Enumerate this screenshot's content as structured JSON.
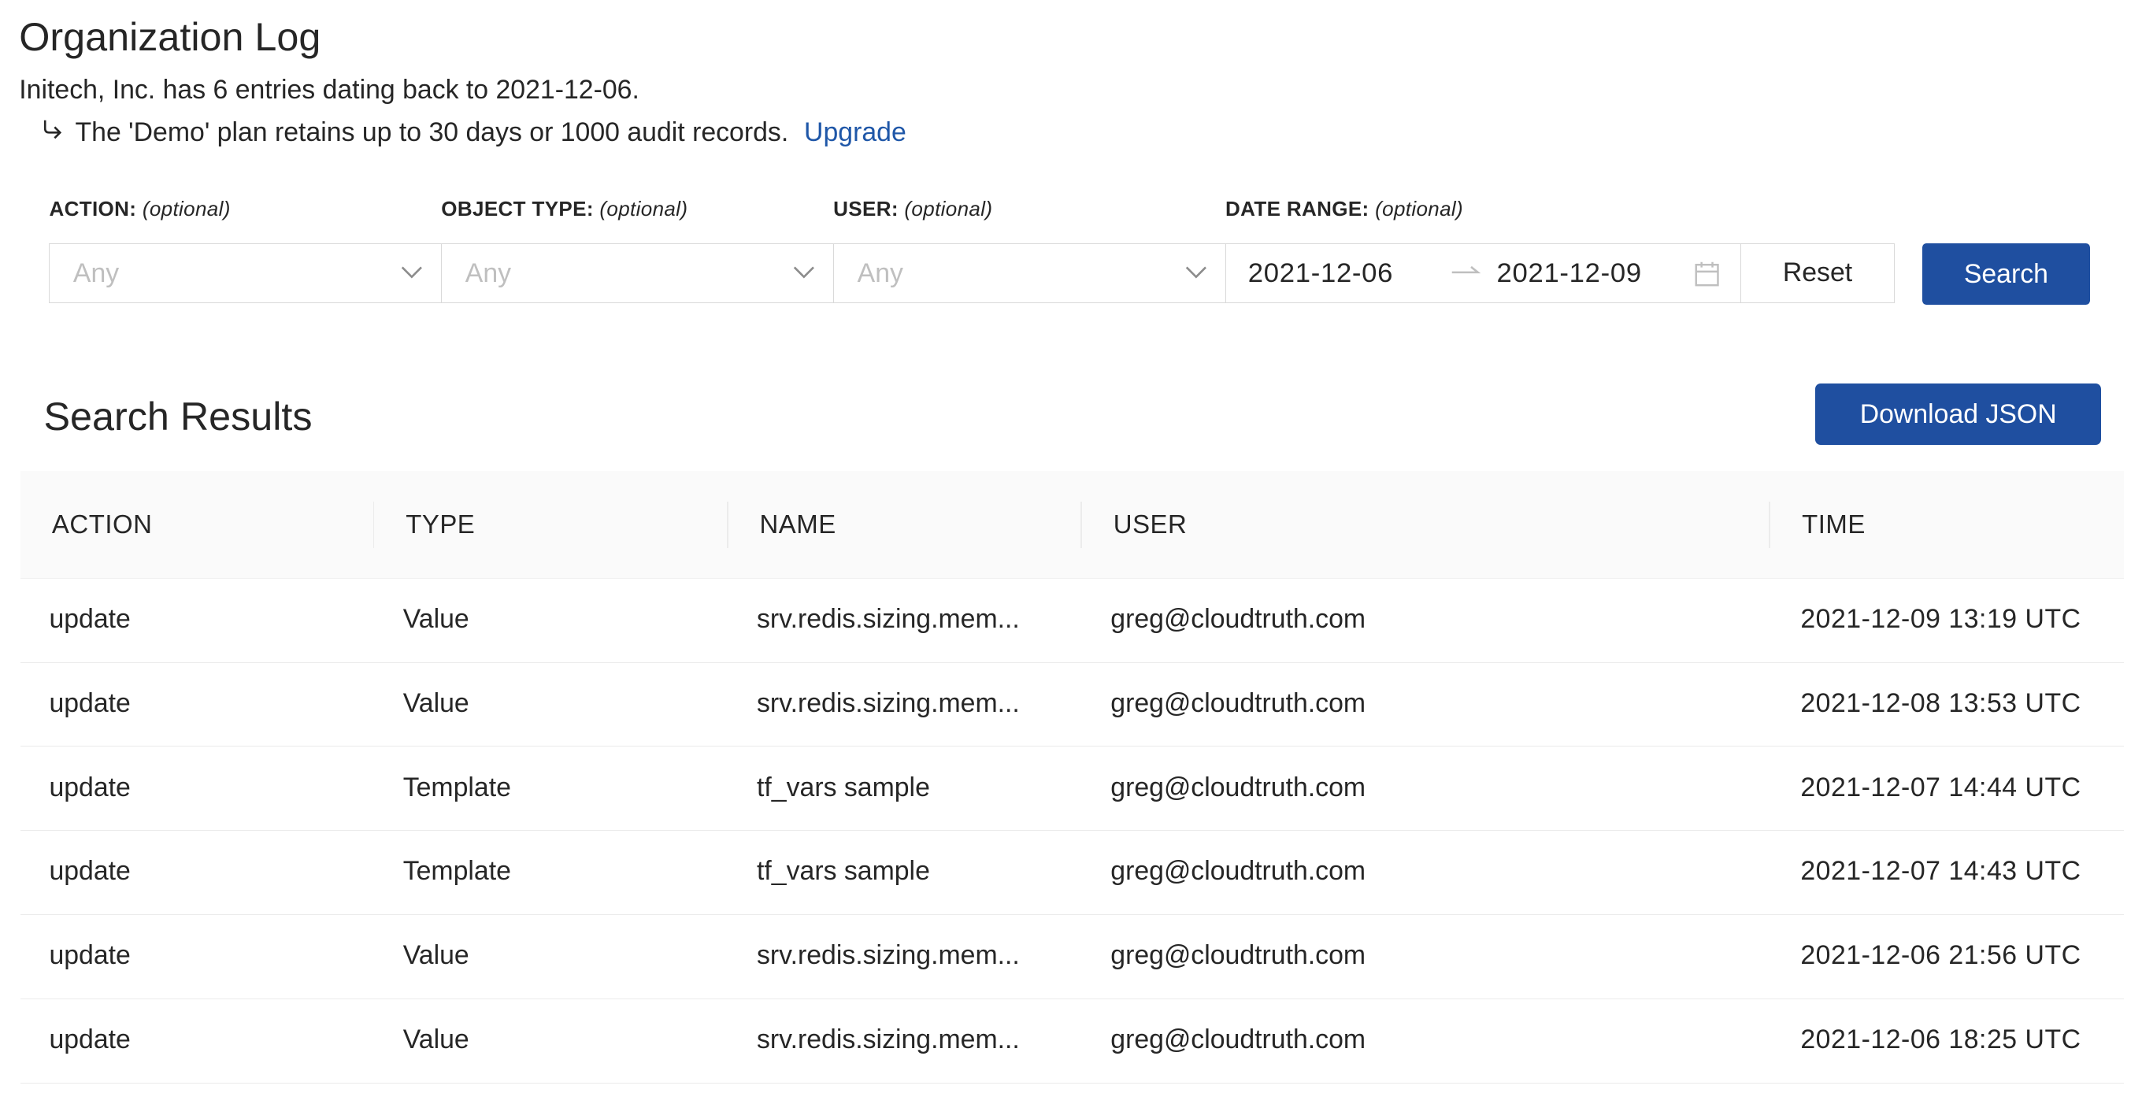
{
  "page": {
    "title": "Organization Log",
    "summary": "Initech, Inc. has 6 entries dating back to 2021-12-06.",
    "plan_note": "The 'Demo' plan retains up to 30 days or 1000 audit records.",
    "upgrade_link": "Upgrade"
  },
  "filters": {
    "action": {
      "label": "ACTION:",
      "hint": "(optional)",
      "placeholder": "Any"
    },
    "object_type": {
      "label": "OBJECT TYPE:",
      "hint": "(optional)",
      "placeholder": "Any"
    },
    "user": {
      "label": "USER:",
      "hint": "(optional)",
      "placeholder": "Any"
    },
    "date_range": {
      "label": "DATE RANGE:",
      "hint": "(optional)",
      "start": "2021-12-06",
      "end": "2021-12-09"
    },
    "reset_label": "Reset",
    "search_label": "Search"
  },
  "results": {
    "title": "Search Results",
    "download_label": "Download JSON",
    "columns": [
      "ACTION",
      "TYPE",
      "NAME",
      "USER",
      "TIME"
    ],
    "rows": [
      {
        "action": "update",
        "type": "Value",
        "name": "srv.redis.sizing.mem...",
        "user": "greg@cloudtruth.com",
        "time": "2021-12-09 13:19 UTC"
      },
      {
        "action": "update",
        "type": "Value",
        "name": "srv.redis.sizing.mem...",
        "user": "greg@cloudtruth.com",
        "time": "2021-12-08 13:53 UTC"
      },
      {
        "action": "update",
        "type": "Template",
        "name": "tf_vars sample",
        "user": "greg@cloudtruth.com",
        "time": "2021-12-07 14:44 UTC"
      },
      {
        "action": "update",
        "type": "Template",
        "name": "tf_vars sample",
        "user": "greg@cloudtruth.com",
        "time": "2021-12-07 14:43 UTC"
      },
      {
        "action": "update",
        "type": "Value",
        "name": "srv.redis.sizing.mem...",
        "user": "greg@cloudtruth.com",
        "time": "2021-12-06 21:56 UTC"
      },
      {
        "action": "update",
        "type": "Value",
        "name": "srv.redis.sizing.mem...",
        "user": "greg@cloudtruth.com",
        "time": "2021-12-06 18:25 UTC"
      }
    ]
  },
  "icons": {
    "select_arrow": "chevron-down-icon",
    "range_separator": "arrow-right-icon",
    "calendar": "calendar-icon",
    "plan_note": "return-arrow-icon"
  },
  "colors": {
    "primary": "#1f4fa0",
    "link": "#1f57a8"
  }
}
